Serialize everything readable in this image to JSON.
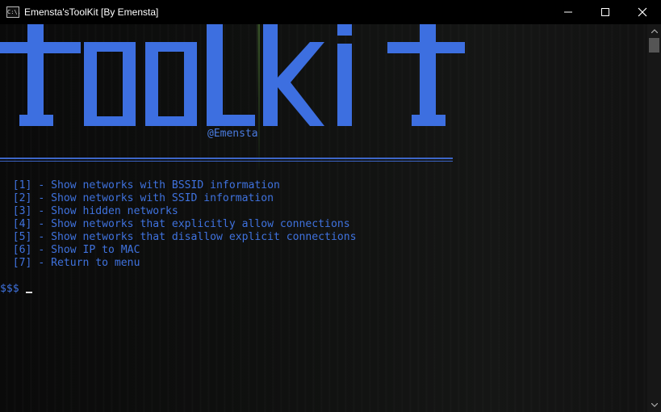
{
  "window": {
    "title": "Emensta'sToolKit [By Emensta]",
    "icon_text": "C:\\."
  },
  "banner": {
    "text": "tOOLKit",
    "handle": "@Emensta",
    "color": "#3d6fe0"
  },
  "menu": [
    {
      "key": "[1]",
      "label": " - Show networks with BSSID information"
    },
    {
      "key": "[2]",
      "label": " - Show networks with SSID information"
    },
    {
      "key": "[3]",
      "label": " - Show hidden networks"
    },
    {
      "key": "[4]",
      "label": " - Show networks that explicitly allow connections"
    },
    {
      "key": "[5]",
      "label": " - Show networks that disallow explicit connections"
    },
    {
      "key": "[6]",
      "label": " - Show IP to MAC"
    },
    {
      "key": "[7]",
      "label": " - Return to menu"
    }
  ],
  "prompt": {
    "text": "$$$"
  },
  "icons": [
    "console-app-icon",
    "minimize-icon",
    "maximize-icon",
    "close-icon",
    "scroll-up-icon",
    "scroll-down-icon"
  ],
  "colors": {
    "accent": "#3f72de",
    "background": "#0c0c0c"
  }
}
